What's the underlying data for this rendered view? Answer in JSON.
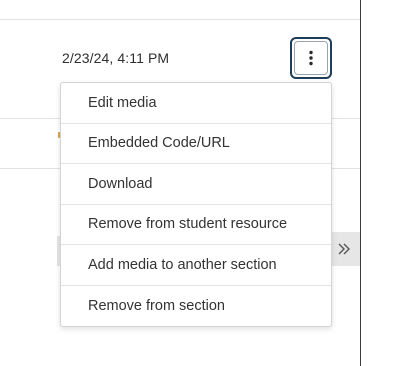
{
  "row": {
    "timestamp": "2/23/24, 4:11 PM"
  },
  "actions_button": {
    "icon": "kebab-vertical-icon"
  },
  "pagination": {
    "next_icon": "double-chevron-right-icon"
  },
  "menu": {
    "items": [
      {
        "label": "Edit media"
      },
      {
        "label": "Embedded Code/URL"
      },
      {
        "label": "Download"
      },
      {
        "label": "Remove from student resource"
      },
      {
        "label": "Add media to another section"
      },
      {
        "label": "Remove from section"
      }
    ]
  },
  "colors": {
    "button_border": "#1e3d59",
    "text": "#333333",
    "divider": "#e3e3e3",
    "accent_glyph": "#d8a64a"
  }
}
